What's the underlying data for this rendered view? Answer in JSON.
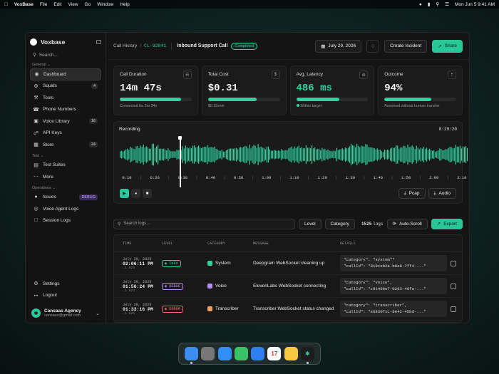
{
  "menubar": {
    "app": "VoxBase",
    "items": [
      "File",
      "Edit",
      "View",
      "Go",
      "Window",
      "Help"
    ],
    "date_time": "Mon Jun 5  9:41 AM"
  },
  "sidebar": {
    "brand": "Voxbase",
    "search_placeholder": "Search...",
    "section_general": "General",
    "section_test": "Test",
    "section_operations": "Operations",
    "general": [
      {
        "label": "Dashboard",
        "icon": "dashboard-icon",
        "badge": ""
      },
      {
        "label": "Squids",
        "icon": "squid-icon",
        "badge": "4"
      },
      {
        "label": "Tools",
        "icon": "wrench-icon",
        "badge": ""
      },
      {
        "label": "Phone Numbers",
        "icon": "phone-icon",
        "badge": ""
      },
      {
        "label": "Voice Library",
        "icon": "voice-library-icon",
        "badge": "16"
      },
      {
        "label": "API Keys",
        "icon": "key-icon",
        "badge": ""
      },
      {
        "label": "Store",
        "icon": "store-icon",
        "badge": "24"
      }
    ],
    "test": [
      {
        "label": "Test Suites",
        "icon": "test-suites-icon"
      },
      {
        "label": "More",
        "icon": "more-icon"
      }
    ],
    "operations": [
      {
        "label": "Issues",
        "icon": "issues-icon",
        "badge": "DEBUG"
      },
      {
        "label": "Voice Agent Logs",
        "icon": "voice-logs-icon"
      },
      {
        "label": "Session Logs",
        "icon": "session-logs-icon"
      }
    ],
    "settings": "Settings",
    "logout": "Logout",
    "account_name": "Cansaas Agency",
    "account_email": "cansaas@gmail.com"
  },
  "topbar": {
    "breadcrumb": "Call History",
    "call_id": "CL-92841",
    "title": "Inbound Support Call",
    "status": "Completed",
    "date": "July 29, 2026",
    "create_incident": "Create Incident",
    "share": "Share"
  },
  "stats": [
    {
      "label": "Call Duration",
      "value": "14m 47s",
      "progress": 0.85,
      "sub": "Connected for 2m 34s",
      "icon": "duration-icon",
      "green": false
    },
    {
      "label": "Total Cost",
      "value": "$0.31",
      "progress": 0.68,
      "sub": "$0.11/min",
      "icon": "cost-icon",
      "green": false
    },
    {
      "label": "Avg. Latency",
      "value": "486 ms",
      "progress": 0.6,
      "sub": "Within target",
      "icon": "latency-icon",
      "green": true
    },
    {
      "label": "Outcome",
      "value": "94%",
      "progress": 0.65,
      "sub": "Resolved without human transfer",
      "icon": "outcome-icon",
      "green": false
    }
  ],
  "recording": {
    "label": "Recording",
    "duration": "0:29:20",
    "ticks": [
      "0:10",
      "0:20",
      "0:30",
      "0:40",
      "0:50",
      "1:00",
      "1:10",
      "1:20",
      "1:30",
      "1:40",
      "1:50",
      "2:00",
      "2:10"
    ],
    "pcap": "Pcap",
    "audio": "Audio"
  },
  "logs": {
    "search_placeholder": "Search logs...",
    "level": "Level",
    "category": "Category",
    "count": "1525",
    "count_suffix": "logs",
    "auto_scroll": "Auto-Scroll",
    "export": "Export",
    "headers": [
      "TIME",
      "LEVEL",
      "CATEGORY",
      "MESSAGE",
      "DETAILS"
    ],
    "rows": [
      {
        "date": "July 29, 2026",
        "time": "02:06:11 PM",
        "ms": ".1.025",
        "level": "INFO",
        "level_color": "#2fd3a0",
        "category": "System",
        "cat_color": "#2fd3a0",
        "message": "Deepgram WebSocket cleaning up",
        "d1": "\"category\": \"system\"\"",
        "d2": "\"callId\": \"819ceb2a-b8e8-7ff4-...\""
      },
      {
        "date": "July 29, 2026",
        "time": "01:56:24 PM",
        "ms": ".1.024",
        "level": "DEBUG",
        "level_color": "#b88cff",
        "category": "Voice",
        "cat_color": "#b88cff",
        "message": "ElevenLabs WebSocket connecting",
        "d1": "\"category\": \"voice\",",
        "d2": "\"callId\": \"c9140be7-02d3-48fa-...\""
      },
      {
        "date": "July 29, 2026",
        "time": "01:33:16 PM",
        "ms": ".1.023",
        "level": "ERROR",
        "level_color": "#ff6b6b",
        "category": "Transcriber",
        "cat_color": "#f0a060",
        "message": "Transcriber WebSocket status changed",
        "d1": "\"category\": \"transcriber\",",
        "d2": "\"callId\": \"e6830f1c-8e42-45bd-...\""
      }
    ]
  },
  "dock": [
    {
      "name": "finder",
      "color": "#3b8ef0"
    },
    {
      "name": "launchpad",
      "color": "#777"
    },
    {
      "name": "safari",
      "color": "#2f8ff5"
    },
    {
      "name": "messages",
      "color": "#38c466"
    },
    {
      "name": "mail",
      "color": "#2f7ff0"
    },
    {
      "name": "calendar",
      "color": "#ffffff",
      "text": "17"
    },
    {
      "name": "notes",
      "color": "#f5c842"
    },
    {
      "name": "voxbase",
      "color": "#1c1c1c"
    }
  ]
}
